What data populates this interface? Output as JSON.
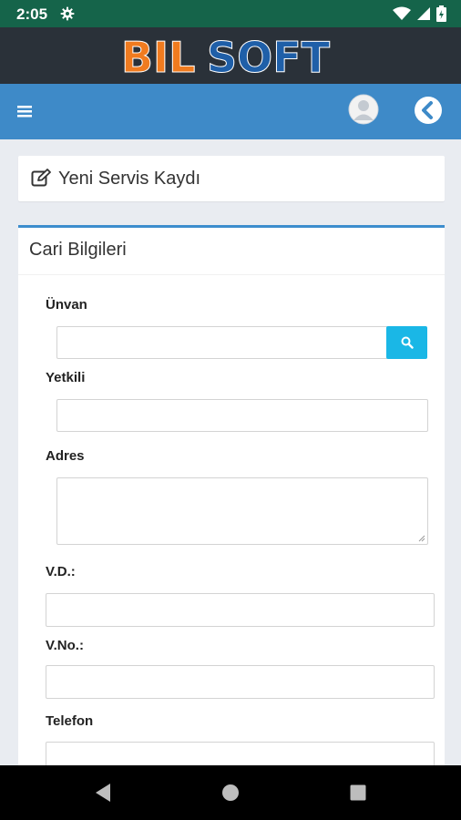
{
  "status_bar": {
    "time": "2:05"
  },
  "brand": {
    "logo_text_a": "BIL",
    "logo_text_b": "SOFT"
  },
  "page_header": {
    "title": "Yeni Servis Kaydı"
  },
  "cari_section": {
    "title": "Cari Bilgileri",
    "fields": {
      "unvan": {
        "label": "Ünvan",
        "value": "",
        "placeholder": ""
      },
      "yetkili": {
        "label": "Yetkili",
        "value": "",
        "placeholder": ""
      },
      "adres": {
        "label": "Adres",
        "value": "",
        "placeholder": ""
      },
      "vd": {
        "label": "V.D.:",
        "value": "",
        "placeholder": ""
      },
      "vno": {
        "label": "V.No.:",
        "value": "",
        "placeholder": ""
      },
      "telefon": {
        "label": "Telefon",
        "value": "",
        "placeholder": ""
      }
    }
  },
  "icons": {
    "menu": "hamburger-icon",
    "profile": "user-avatar-icon",
    "back": "chevron-left-icon",
    "edit": "edit-icon",
    "search": "search-icon"
  },
  "colors": {
    "status_bar": "#15644a",
    "brand_bar": "#2a3139",
    "toolbar": "#3e8ac8",
    "accent": "#3c8dcd",
    "search_button": "#1ab7e6",
    "logo_orange": "#f07b1f",
    "logo_blue": "#1f5fa8"
  }
}
